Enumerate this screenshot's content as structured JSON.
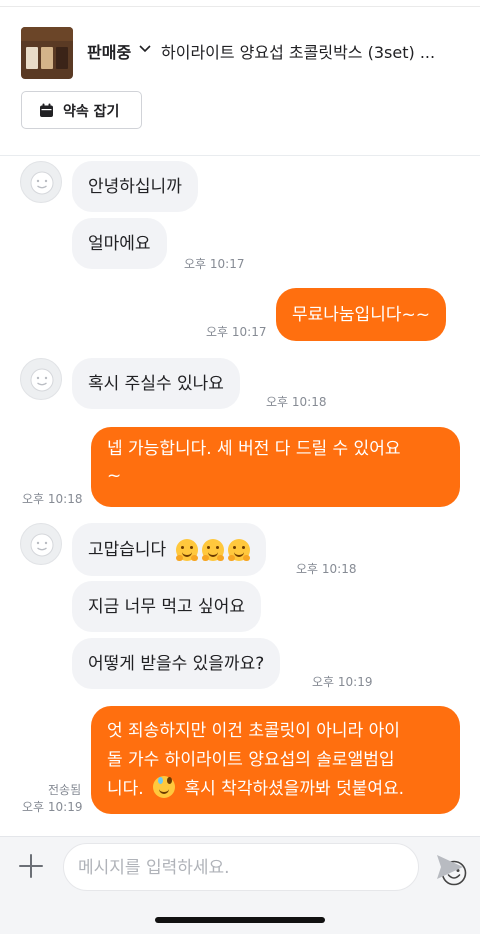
{
  "header": {
    "status": "판매중",
    "product_title": "하이라이트 양요섭 초콜릿박스 (3set) ...",
    "appointment_button": "약속 잡기"
  },
  "messages": {
    "m1_text": "안녕하십니까",
    "m2_text": "얼마에요",
    "m2_time": "오후 10:17",
    "m3_text": "무료나눔입니다~~",
    "m3_time": "오후 10:17",
    "m4_text": "혹시 주실수 있나요",
    "m4_time": "오후 10:18",
    "m5_line1": "넵 가능합니다. 세 버전 다 드릴 수 있어요",
    "m5_line2": "~",
    "m5_time": "오후 10:18",
    "m6_text": "고맙습니다",
    "m6_time": "오후 10:18",
    "m7_text": "지금 너무 먹고 싶어요",
    "m8_text": "어떻게 받을수 있을까요?",
    "m8_time": "오후 10:19",
    "m9_line1": "엇 죄송하지만 이건 초콜릿이 아니라 아이",
    "m9_line2": "돌 가수 하이라이트 양요섭의 솔로앨범입",
    "m9_line3_before": "니다.",
    "m9_line3_after": "혹시 착각하셨을까봐 덧붙여요.",
    "m9_status": "전송됨",
    "m9_time": "오후 10:19"
  },
  "composer": {
    "placeholder": "메시지를 입력하세요."
  },
  "icons": {
    "calendar": "calendar-icon",
    "plus": "plus-icon",
    "emoji": "smile-icon",
    "send": "send-icon",
    "avatar": "default-avatar-icon"
  },
  "colors": {
    "accent": "#ff6f0f",
    "incoming_bubble": "#f2f3f6",
    "timestamp": "#868b94"
  }
}
